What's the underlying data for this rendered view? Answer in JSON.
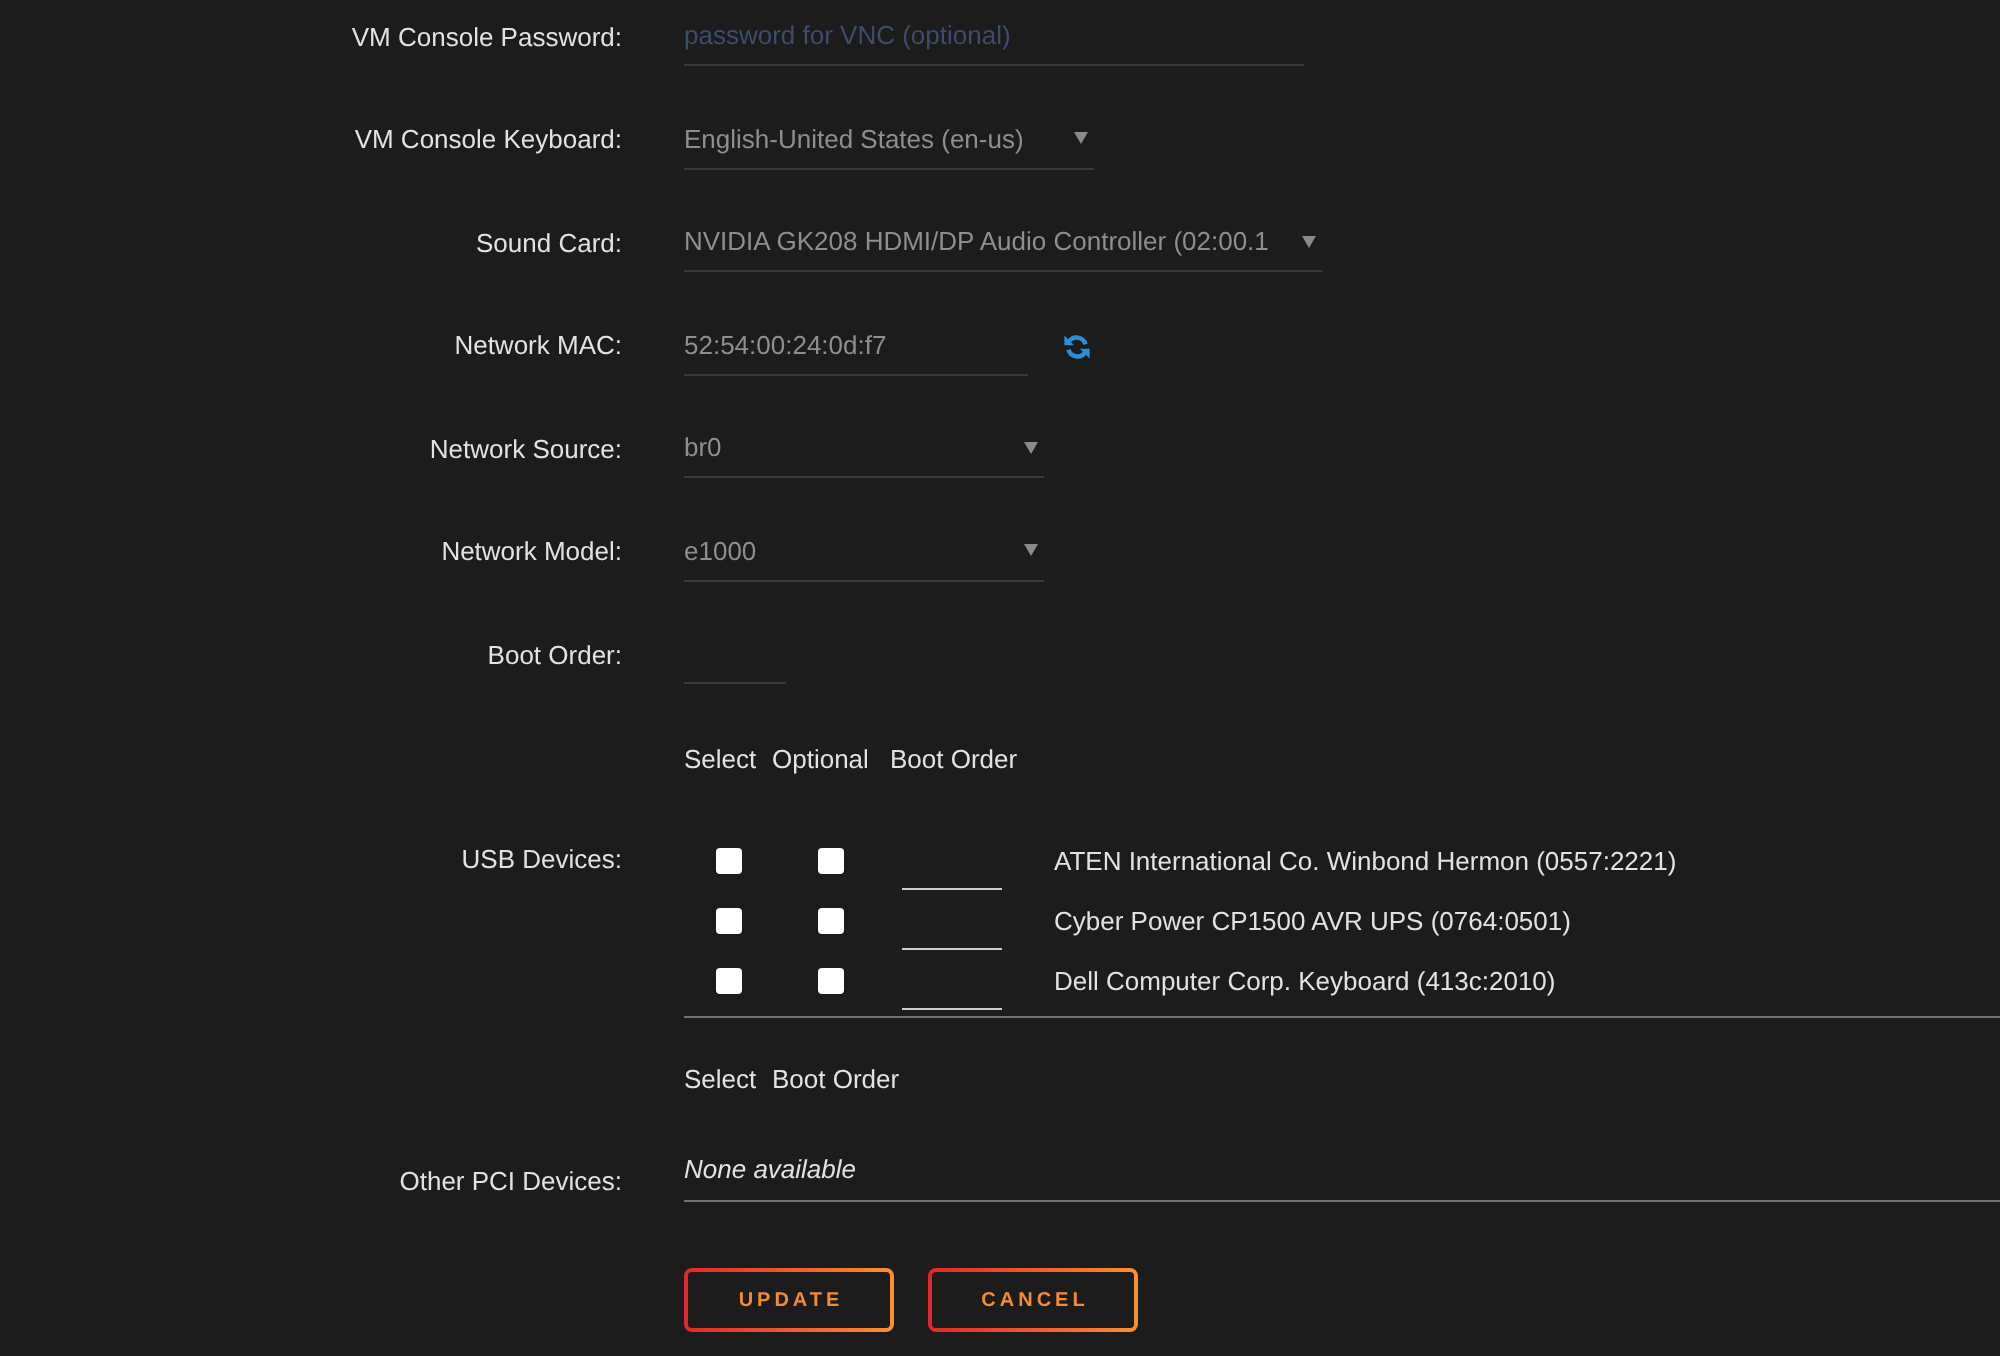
{
  "fields": [
    {
      "kind": "input",
      "label": "VM Console Password:",
      "placeholder": "password for VNC (optional)"
    },
    {
      "kind": "select",
      "label": "VM Console Keyboard:",
      "value": "English-United States (en-us)"
    },
    {
      "kind": "select",
      "label": "Sound Card:",
      "value": "NVIDIA GK208 HDMI/DP Audio Controller (02:00.1"
    },
    {
      "kind": "input",
      "label": "Network MAC:",
      "value": "52:54:00:24:0d:f7",
      "refresh_button": true
    },
    {
      "kind": "select",
      "label": "Network Source:",
      "value": "br0"
    },
    {
      "kind": "select",
      "label": "Network Model:",
      "value": "e1000"
    },
    {
      "kind": "input",
      "label": "Boot Order:"
    }
  ],
  "usb_devices": {
    "label": "USB Devices:",
    "columns": [
      "Select",
      "Optional",
      "Boot Order"
    ],
    "rows": [
      {
        "name": "ATEN International Co. Winbond Hermon (0557:2221)",
        "checked": false,
        "optional": false
      },
      {
        "name": "Cyber Power CP1500 AVR UPS (0764:0501)",
        "checked": false,
        "optional": false
      },
      {
        "name": "Dell Computer Corp. Keyboard (413c:2010)",
        "checked": false,
        "optional": false
      }
    ]
  },
  "pci_devices": {
    "label": "Other PCI Devices:",
    "columns": [
      "Select",
      "Boot Order"
    ],
    "message": "None available"
  },
  "buttons": [
    "UPDATE",
    "CANCEL"
  ]
}
